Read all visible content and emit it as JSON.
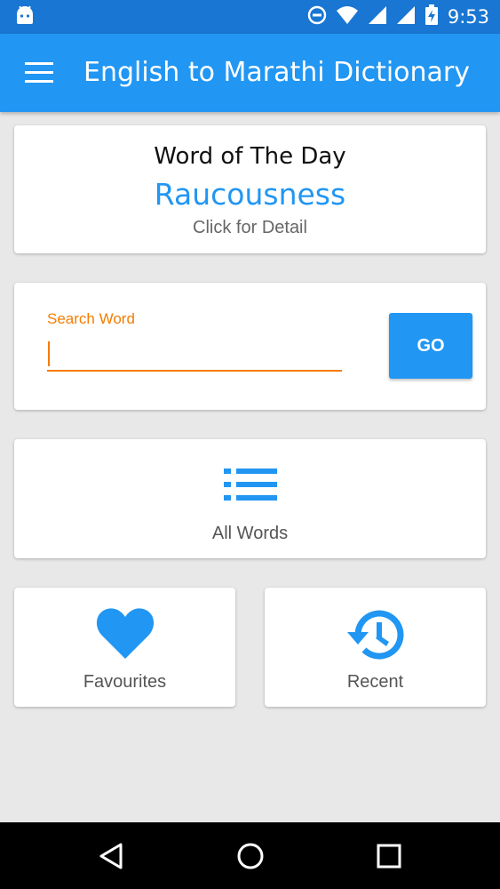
{
  "status_bar": {
    "time": "9:53",
    "color": "#1976d2"
  },
  "app_bar": {
    "title": "English to Marathi Dictionary",
    "color": "#2196f3"
  },
  "word_of_day": {
    "heading": "Word of The Day",
    "word": "Raucousness",
    "detail": "Click for Detail"
  },
  "search": {
    "label": "Search Word",
    "value": "",
    "go_label": "GO",
    "accent": "#f57c00"
  },
  "menu": {
    "all_words": {
      "label": "All Words",
      "icon": "list-icon"
    },
    "favourites": {
      "label": "Favourites",
      "icon": "heart-icon"
    },
    "recent": {
      "label": "Recent",
      "icon": "history-icon"
    }
  },
  "nav_bar": {
    "buttons": [
      "back-icon",
      "home-icon",
      "recents-icon"
    ]
  }
}
